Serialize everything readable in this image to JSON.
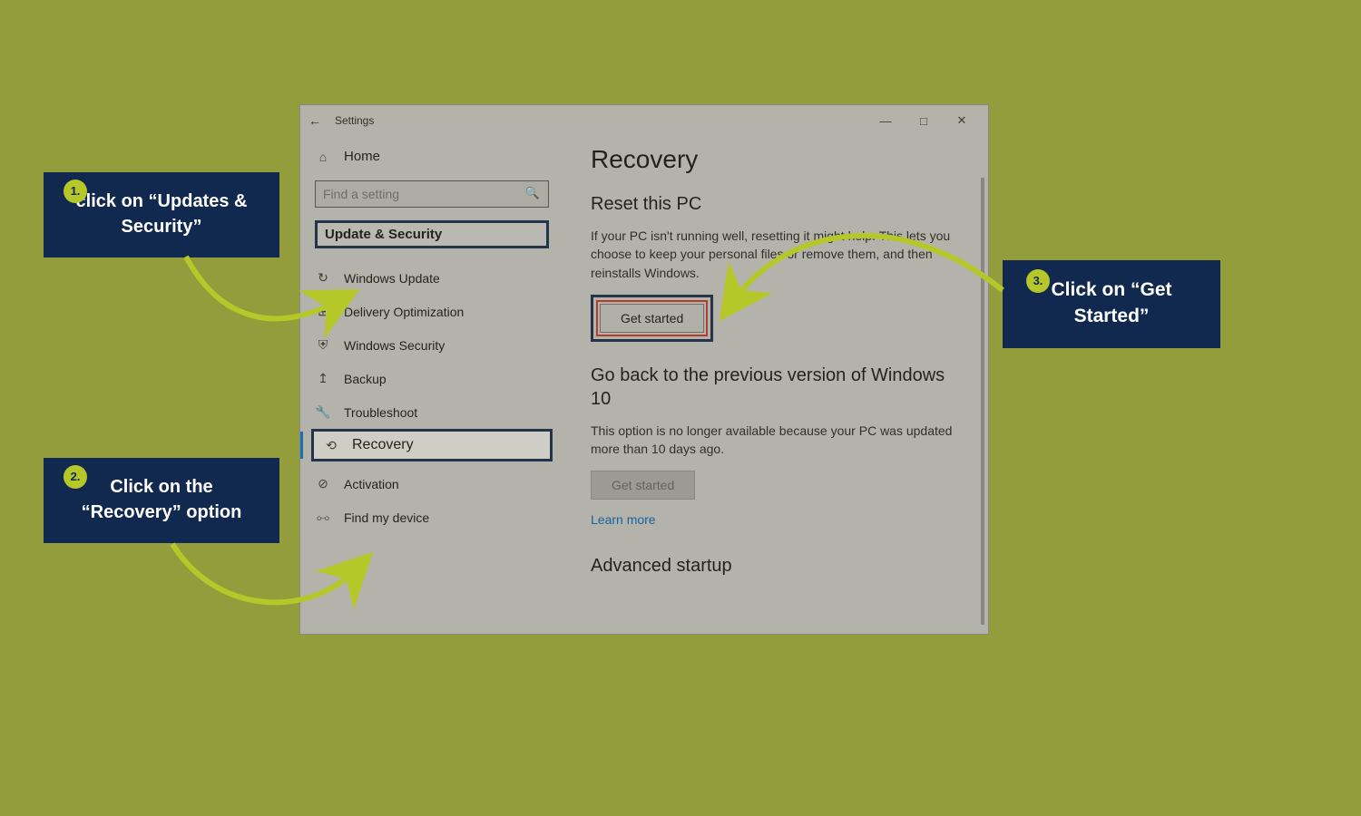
{
  "window": {
    "title": "Settings",
    "home": "Home",
    "search_placeholder": "Find a setting",
    "category_header": "Update & Security",
    "nav": [
      {
        "icon": "↻",
        "label": "Windows Update"
      },
      {
        "icon": "⊞",
        "label": "Delivery Optimization"
      },
      {
        "icon": "⛨",
        "label": "Windows Security"
      },
      {
        "icon": "↥",
        "label": "Backup"
      },
      {
        "icon": "🔧",
        "label": "Troubleshoot"
      },
      {
        "icon": "⟲",
        "label": "Recovery"
      },
      {
        "icon": "⊘",
        "label": "Activation"
      },
      {
        "icon": "⧟",
        "label": "Find my device"
      }
    ]
  },
  "main": {
    "title": "Recovery",
    "reset": {
      "heading": "Reset this PC",
      "desc": "If your PC isn't running well, resetting it might help. This lets you choose to keep your personal files or remove them, and then reinstalls Windows.",
      "button": "Get started"
    },
    "goback": {
      "heading": "Go back to the previous version of Windows 10",
      "desc": "This option is no longer available because your PC was updated more than 10 days ago.",
      "button": "Get started",
      "link": "Learn more"
    },
    "advanced_heading": "Advanced startup"
  },
  "callouts": {
    "c1": {
      "num": "1.",
      "text": "click on “Updates & Security”"
    },
    "c2": {
      "num": "2.",
      "text": "Click on the “Recovery” option"
    },
    "c3": {
      "num": "3.",
      "text": "Click on “Get Started”"
    }
  }
}
